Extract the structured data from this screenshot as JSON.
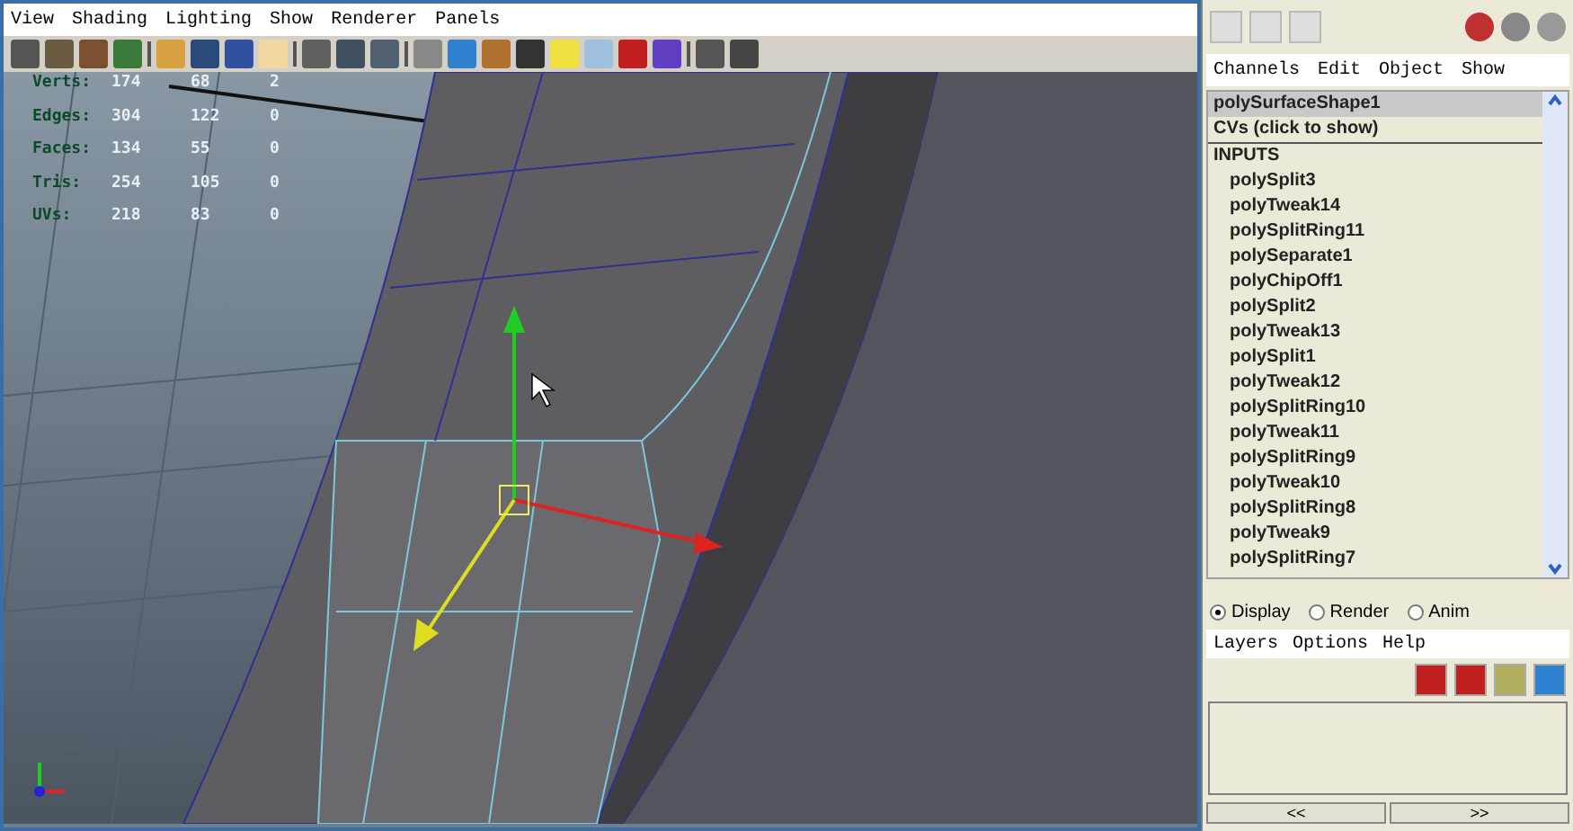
{
  "viewport": {
    "menu": [
      "View",
      "Shading",
      "Lighting",
      "Show",
      "Renderer",
      "Panels"
    ],
    "hud": [
      {
        "label": "Verts:",
        "values": [
          "174",
          "68",
          "2"
        ]
      },
      {
        "label": "Edges:",
        "values": [
          "304",
          "122",
          "0"
        ]
      },
      {
        "label": "Faces:",
        "values": [
          "134",
          "55",
          "0"
        ]
      },
      {
        "label": "Tris:",
        "values": [
          "254",
          "105",
          "0"
        ]
      },
      {
        "label": "UVs:",
        "values": [
          "218",
          "83",
          "0"
        ]
      }
    ]
  },
  "channel_box": {
    "menu": [
      "Channels",
      "Edit",
      "Object",
      "Show"
    ],
    "shape": {
      "label": "polySurfaceShape1",
      "selected": true
    },
    "cvs": "CVs (click to show)",
    "inputs_heading": "INPUTS",
    "inputs": [
      "polySplit3",
      "polyTweak14",
      "polySplitRing11",
      "polySeparate1",
      "polyChipOff1",
      "polySplit2",
      "polyTweak13",
      "polySplit1",
      "polyTweak12",
      "polySplitRing10",
      "polyTweak11",
      "polySplitRing9",
      "polyTweak10",
      "polySplitRing8",
      "polyTweak9",
      "polySplitRing7"
    ]
  },
  "layer_editor": {
    "modes": [
      {
        "label": "Display",
        "selected": true
      },
      {
        "label": "Render",
        "selected": false
      },
      {
        "label": "Anim",
        "selected": false
      }
    ],
    "menu": [
      "Layers",
      "Options",
      "Help"
    ],
    "nav": [
      "<<",
      ">>"
    ]
  }
}
